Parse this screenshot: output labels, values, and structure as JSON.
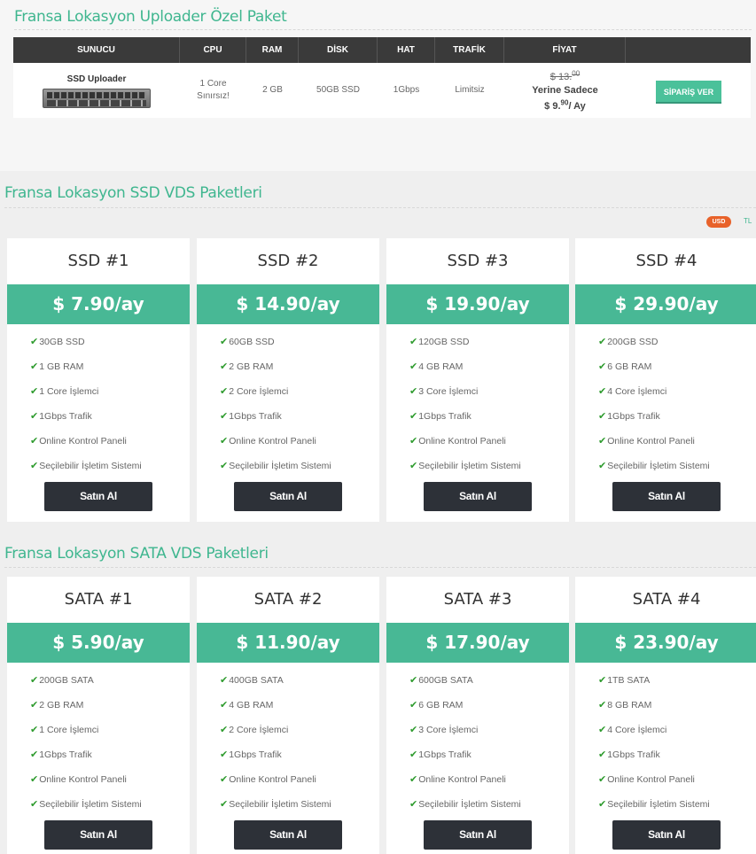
{
  "uploader": {
    "title": "Fransa Lokasyon Uploader Özel Paket",
    "headers": [
      "SUNUCU",
      "CPU",
      "RAM",
      "DİSK",
      "HAT",
      "TRAFİK",
      "FİYAT"
    ],
    "server_name": "SSD Uploader",
    "cpu_line1": "1 Core",
    "cpu_line2": "Sınırsız!",
    "ram": "2 GB",
    "disk": "50GB SSD",
    "hat": "1Gbps",
    "trafik": "Limitsiz",
    "old_price_main": "$ 13.",
    "old_price_sup": "00",
    "yerine": "Yerine Sadece",
    "new_price_main": "$ 9.",
    "new_price_sup": "90",
    "new_price_suffix": "/ Ay",
    "order_label": "SİPARİŞ VER"
  },
  "currency": {
    "usd": "USD",
    "tl": "TL",
    "active": "USD",
    "active_color": "#e8622a"
  },
  "ssd": {
    "title": "Fransa Lokasyon SSD VDS Paketleri",
    "cards": [
      {
        "name": "SSD #1",
        "price": "$ 7.90/ay",
        "features": [
          "30GB SSD",
          "1 GB RAM",
          "1 Core İşlemci",
          "1Gbps Trafik",
          "Online Kontrol Paneli",
          "Seçilebilir İşletim Sistemi"
        ],
        "button": "Satın Al"
      },
      {
        "name": "SSD #2",
        "price": "$ 14.90/ay",
        "features": [
          "60GB SSD",
          "2 GB RAM",
          "2 Core İşlemci",
          "1Gbps Trafik",
          "Online Kontrol Paneli",
          "Seçilebilir İşletim Sistemi"
        ],
        "button": "Satın Al"
      },
      {
        "name": "SSD #3",
        "price": "$ 19.90/ay",
        "features": [
          "120GB SSD",
          "4 GB RAM",
          "3 Core İşlemci",
          "1Gbps Trafik",
          "Online Kontrol Paneli",
          "Seçilebilir İşletim Sistemi"
        ],
        "button": "Satın Al"
      },
      {
        "name": "SSD #4",
        "price": "$ 29.90/ay",
        "features": [
          "200GB SSD",
          "6 GB RAM",
          "4 Core İşlemci",
          "1Gbps Trafik",
          "Online Kontrol Paneli",
          "Seçilebilir İşletim Sistemi"
        ],
        "button": "Satın Al"
      }
    ]
  },
  "sata": {
    "title": "Fransa Lokasyon SATA VDS Paketleri",
    "cards": [
      {
        "name": "SATA #1",
        "price": "$ 5.90/ay",
        "features": [
          "200GB SATA",
          "2 GB RAM",
          "1 Core İşlemci",
          "1Gbps Trafik",
          "Online Kontrol Paneli",
          "Seçilebilir İşletim Sistemi"
        ],
        "button": "Satın Al"
      },
      {
        "name": "SATA #2",
        "price": "$ 11.90/ay",
        "features": [
          "400GB SATA",
          "4 GB RAM",
          "2 Core İşlemci",
          "1Gbps Trafik",
          "Online Kontrol Paneli",
          "Seçilebilir İşletim Sistemi"
        ],
        "button": "Satın Al"
      },
      {
        "name": "SATA #3",
        "price": "$ 17.90/ay",
        "features": [
          "600GB SATA",
          "6 GB RAM",
          "3 Core İşlemci",
          "1Gbps Trafik",
          "Online Kontrol Paneli",
          "Seçilebilir İşletim Sistemi"
        ],
        "button": "Satın Al"
      },
      {
        "name": "SATA #4",
        "price": "$ 23.90/ay",
        "features": [
          "1TB SATA",
          "8 GB RAM",
          "4 Core İşlemci",
          "1Gbps Trafik",
          "Online Kontrol Paneli",
          "Seçilebilir İşletim Sistemi"
        ],
        "button": "Satın Al"
      }
    ]
  },
  "colors": {
    "accent": "#48b895",
    "title": "#3fb68f",
    "button_dark": "#2d3138",
    "check": "#2e9b2e"
  }
}
